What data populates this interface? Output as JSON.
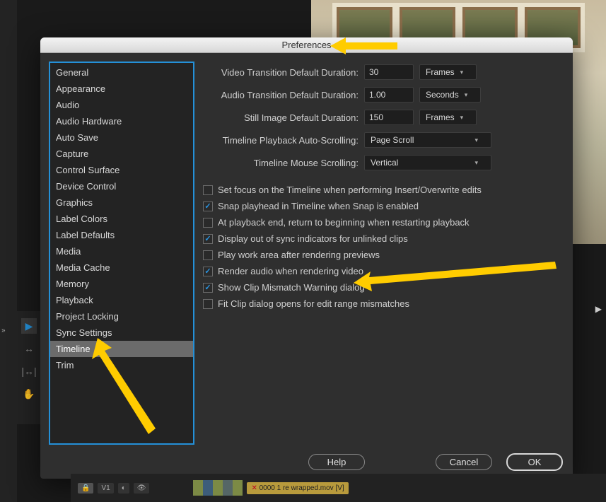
{
  "dialog": {
    "title": "Preferences",
    "buttons": {
      "help": "Help",
      "cancel": "Cancel",
      "ok": "OK"
    }
  },
  "sidebar": {
    "selected_index": 17,
    "items": [
      {
        "label": "General"
      },
      {
        "label": "Appearance"
      },
      {
        "label": "Audio"
      },
      {
        "label": "Audio Hardware"
      },
      {
        "label": "Auto Save"
      },
      {
        "label": "Capture"
      },
      {
        "label": "Control Surface"
      },
      {
        "label": "Device Control"
      },
      {
        "label": "Graphics"
      },
      {
        "label": "Label Colors"
      },
      {
        "label": "Label Defaults"
      },
      {
        "label": "Media"
      },
      {
        "label": "Media Cache"
      },
      {
        "label": "Memory"
      },
      {
        "label": "Playback"
      },
      {
        "label": "Project Locking"
      },
      {
        "label": "Sync Settings"
      },
      {
        "label": "Timeline"
      },
      {
        "label": "Trim"
      }
    ]
  },
  "panel": {
    "settings": [
      {
        "label": "Video Transition Default Duration:",
        "value": "30",
        "unit": "Frames"
      },
      {
        "label": "Audio Transition Default Duration:",
        "value": "1.00",
        "unit": "Seconds"
      },
      {
        "label": "Still Image Default Duration:",
        "value": "150",
        "unit": "Frames"
      }
    ],
    "scroll": [
      {
        "label": "Timeline Playback Auto-Scrolling:",
        "value": "Page Scroll"
      },
      {
        "label": "Timeline Mouse Scrolling:",
        "value": "Vertical"
      }
    ],
    "checks": [
      {
        "checked": false,
        "label": "Set focus on the Timeline when performing Insert/Overwrite edits"
      },
      {
        "checked": true,
        "label": "Snap playhead in Timeline when Snap is enabled"
      },
      {
        "checked": false,
        "label": "At playback end, return to beginning when restarting playback"
      },
      {
        "checked": true,
        "label": "Display out of sync indicators for unlinked clips"
      },
      {
        "checked": false,
        "label": "Play work area after rendering previews"
      },
      {
        "checked": true,
        "label": "Render audio when rendering video"
      },
      {
        "checked": true,
        "label": "Show Clip Mismatch Warning dialog"
      },
      {
        "checked": false,
        "label": "Fit Clip dialog opens for edit range mismatches"
      }
    ]
  },
  "timeline": {
    "track1": "V1",
    "clip_label": "0000 1 re wrapped.mov [V]"
  },
  "arrows": {
    "color": "#FFCC00"
  }
}
